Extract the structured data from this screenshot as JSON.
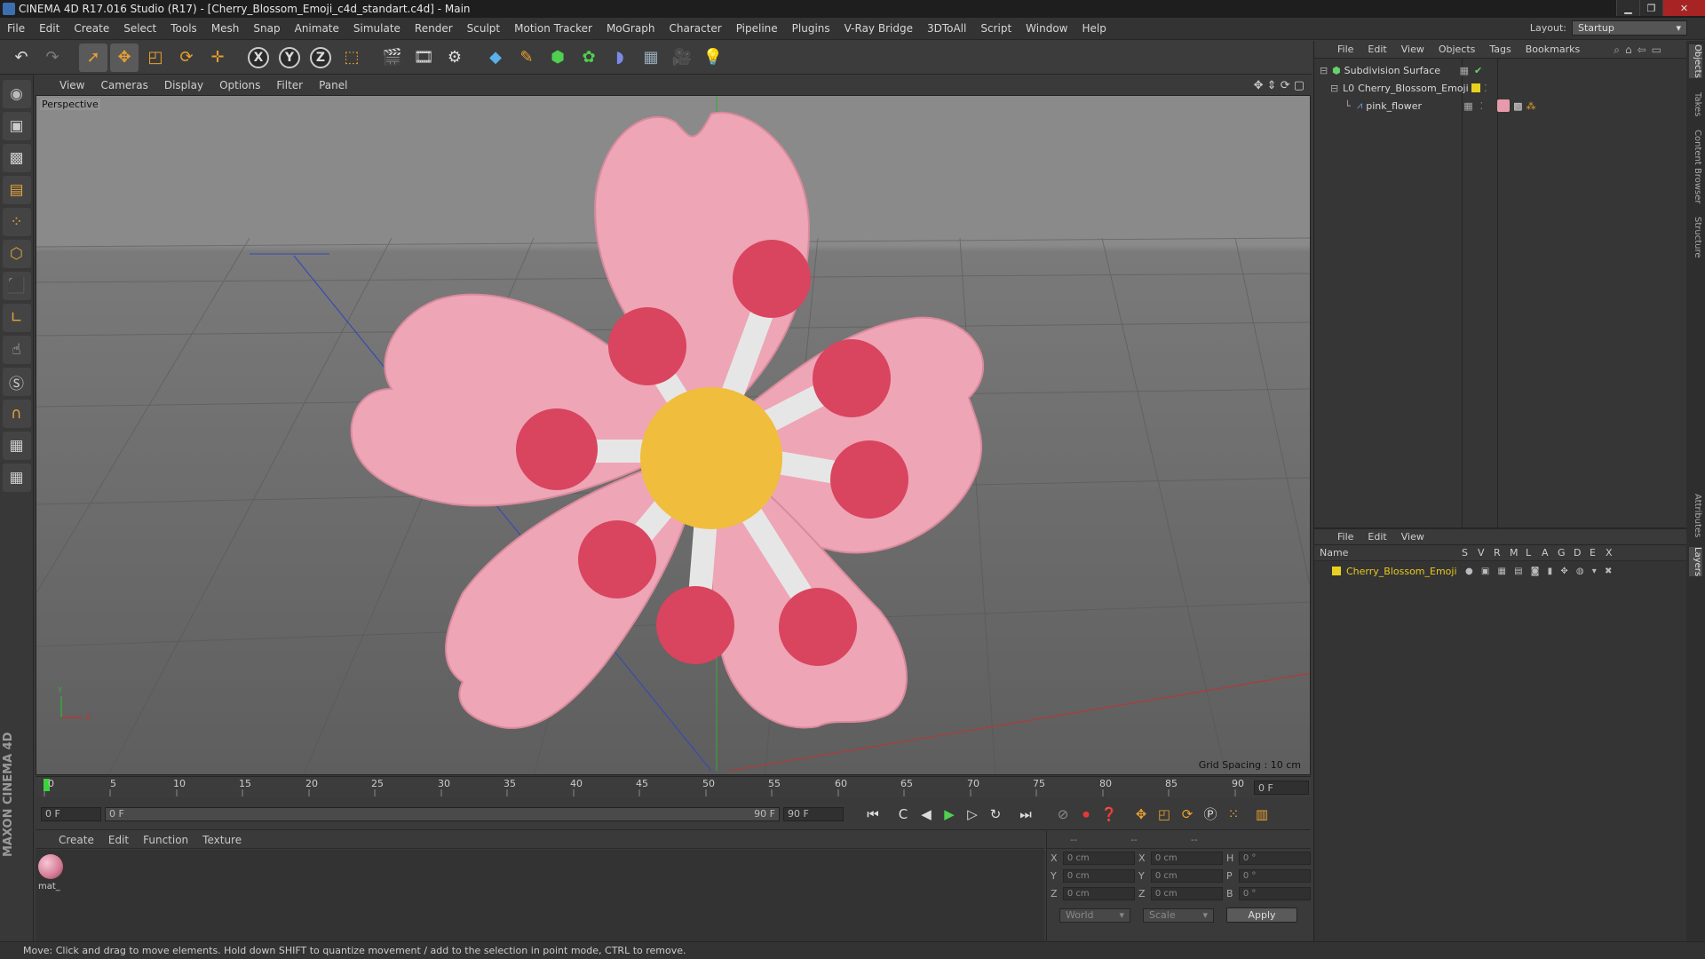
{
  "window": {
    "title": "CINEMA 4D R17.016 Studio (R17) - [Cherry_Blossom_Emoji_c4d_standart.c4d] - Main",
    "minimize": "▁",
    "maximize": "❐",
    "close": "✕"
  },
  "menubar": {
    "items": [
      "File",
      "Edit",
      "Create",
      "Select",
      "Tools",
      "Mesh",
      "Snap",
      "Animate",
      "Simulate",
      "Render",
      "Sculpt",
      "Motion Tracker",
      "MoGraph",
      "Character",
      "Pipeline",
      "Plugins",
      "V-Ray Bridge",
      "3DToAll",
      "Script",
      "Window",
      "Help"
    ],
    "layout_label": "Layout:",
    "layout_value": "Startup"
  },
  "toolbar": {
    "axis_x": "X",
    "axis_y": "Y",
    "axis_z": "Z"
  },
  "viewport": {
    "menu": [
      "View",
      "Cameras",
      "Display",
      "Options",
      "Filter",
      "Panel"
    ],
    "label": "Perspective",
    "grid_spacing": "Grid Spacing : 10 cm",
    "axis_y": "Y",
    "axis_x": "X",
    "colors": {
      "petal": "#eea5b6",
      "petal_shadow": "#d98a9c",
      "center": "#f0bd3c",
      "ball": "#d9445e",
      "stem": "#e6e6e6"
    }
  },
  "timeline": {
    "ticks": [
      "0",
      "5",
      "10",
      "15",
      "20",
      "25",
      "30",
      "35",
      "40",
      "45",
      "50",
      "55",
      "60",
      "65",
      "70",
      "75",
      "80",
      "85",
      "90"
    ],
    "current_frame": "0 F"
  },
  "transport": {
    "start_field": "0 F",
    "range_start": "0 F",
    "range_end": "90 F",
    "end_field": "90 F"
  },
  "material_manager": {
    "menu": [
      "Create",
      "Edit",
      "Function",
      "Texture"
    ],
    "materials": [
      {
        "name": "mat_"
      }
    ]
  },
  "coordinates": {
    "head": [
      "--",
      "--",
      "--"
    ],
    "rows": [
      {
        "axis": "X",
        "pos": "0 cm",
        "axis2": "X",
        "size": "0 cm",
        "rot_label": "H",
        "rot": "0 °"
      },
      {
        "axis": "Y",
        "pos": "0 cm",
        "axis2": "Y",
        "size": "0 cm",
        "rot_label": "P",
        "rot": "0 °"
      },
      {
        "axis": "Z",
        "pos": "0 cm",
        "axis2": "Z",
        "size": "0 cm",
        "rot_label": "B",
        "rot": "0 °"
      }
    ],
    "space": "World",
    "mode": "Scale",
    "apply": "Apply"
  },
  "object_manager": {
    "menu": [
      "File",
      "Edit",
      "View",
      "Objects",
      "Tags",
      "Bookmarks"
    ],
    "objects": [
      {
        "name": "Subdivision Surface",
        "indent": 0
      },
      {
        "name": "Cherry_Blossom_Emoji",
        "indent": 1
      },
      {
        "name": "pink_flower",
        "indent": 2
      }
    ]
  },
  "layer_manager": {
    "menu": [
      "File",
      "Edit",
      "View"
    ],
    "columns": [
      "Name",
      "S",
      "V",
      "R",
      "M",
      "L",
      "A",
      "G",
      "D",
      "E",
      "X"
    ],
    "layers": [
      {
        "name": "Cherry_Blossom_Emoji",
        "color": "#e8d020"
      }
    ]
  },
  "side_tabs": [
    "Objects",
    "Takes",
    "Content Browser",
    "Structure",
    "Attributes",
    "Layers"
  ],
  "status": "Move: Click and drag to move elements. Hold down SHIFT to quantize movement / add to the selection in point mode, CTRL to remove.",
  "branding": "MAXON CINEMA 4D"
}
